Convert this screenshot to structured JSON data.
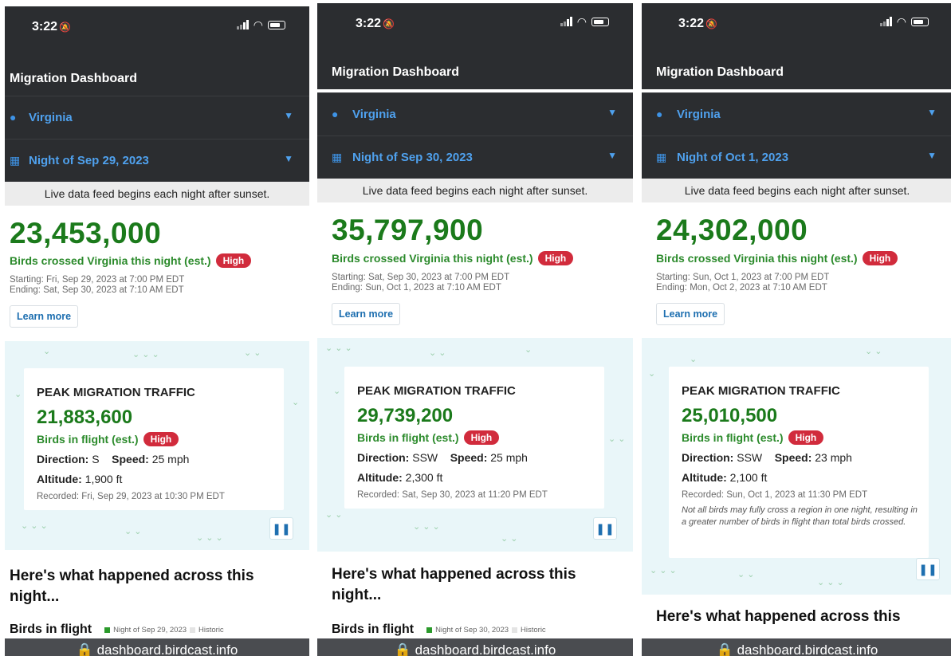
{
  "colors": {
    "header_bg": "#2b2d30",
    "accent_blue": "#4fa1ee",
    "count_green": "#1b7a1b",
    "badge_red": "#d12b3c",
    "map_bg": "#e9f6f9"
  },
  "icons": {
    "location": "globe-icon",
    "date": "calendar-icon",
    "dropdown": "chevron-down-icon",
    "pause": "pause-icon",
    "lock": "lock-icon"
  },
  "screens": [
    {
      "status_time": "3:22",
      "app_title": "Migration Dashboard",
      "region": "Virginia",
      "night": "Night of Sep 29, 2023",
      "notice": "Live data feed begins each night after sunset.",
      "total_birds": "23,453,000",
      "crossed_label": "Birds crossed Virginia this night (est.)",
      "intensity": "High",
      "starting": "Starting: Fri, Sep 29, 2023 at 7:00 PM EDT",
      "ending": "Ending: Sat, Sep 30, 2023 at 7:10 AM EDT",
      "learn_more": "Learn more",
      "peak": {
        "title": "PEAK MIGRATION TRAFFIC",
        "count": "21,883,600",
        "label": "Birds in flight (est.)",
        "intensity": "High",
        "direction_label": "Direction:",
        "direction": "S",
        "speed_label": "Speed:",
        "speed": "25 mph",
        "altitude_label": "Altitude:",
        "altitude": "1,900 ft",
        "recorded": "Recorded: Fri, Sep 29, 2023 at 10:30 PM EDT"
      },
      "section_title": "Here's what happened across this night...",
      "chart_title": "Birds in flight",
      "legend_night": "Night of Sep 29, 2023",
      "legend_historic": "Historic",
      "url": "dashboard.birdcast.info"
    },
    {
      "status_time": "3:22",
      "app_title": "Migration Dashboard",
      "region": "Virginia",
      "night": "Night of Sep 30, 2023",
      "notice": "Live data feed begins each night after sunset.",
      "total_birds": "35,797,900",
      "crossed_label": "Birds crossed Virginia this night (est.)",
      "intensity": "High",
      "starting": "Starting: Sat, Sep 30, 2023 at 7:00 PM EDT",
      "ending": "Ending: Sun, Oct 1, 2023 at 7:10 AM EDT",
      "learn_more": "Learn more",
      "peak": {
        "title": "PEAK MIGRATION TRAFFIC",
        "count": "29,739,200",
        "label": "Birds in flight (est.)",
        "intensity": "High",
        "direction_label": "Direction:",
        "direction": "SSW",
        "speed_label": "Speed:",
        "speed": "25 mph",
        "altitude_label": "Altitude:",
        "altitude": "2,300 ft",
        "recorded": "Recorded: Sat, Sep 30, 2023 at 11:20 PM EDT"
      },
      "section_title": "Here's what happened across this night...",
      "chart_title": "Birds in flight",
      "legend_night": "Night of Sep 30, 2023",
      "legend_historic": "Historic",
      "url": "dashboard.birdcast.info"
    },
    {
      "status_time": "3:22",
      "app_title": "Migration Dashboard",
      "region": "Virginia",
      "night": "Night of Oct 1, 2023",
      "notice": "Live data feed begins each night after sunset.",
      "total_birds": "24,302,000",
      "crossed_label": "Birds crossed Virginia this night (est.)",
      "intensity": "High",
      "starting": "Starting: Sun, Oct 1, 2023 at 7:00 PM EDT",
      "ending": "Ending: Mon, Oct 2, 2023 at 7:10 AM EDT",
      "learn_more": "Learn more",
      "peak": {
        "title": "PEAK MIGRATION TRAFFIC",
        "count": "25,010,500",
        "label": "Birds in flight (est.)",
        "intensity": "High",
        "direction_label": "Direction:",
        "direction": "SSW",
        "speed_label": "Speed:",
        "speed": "23 mph",
        "altitude_label": "Altitude:",
        "altitude": "2,100 ft",
        "recorded": "Recorded: Sun, Oct 1, 2023 at 11:30 PM EDT",
        "note": "Not all birds may fully cross a region in one night, resulting in a greater number of birds in flight than total birds crossed."
      },
      "section_title": "Here's what happened across this night",
      "url": "dashboard.birdcast.info"
    }
  ]
}
